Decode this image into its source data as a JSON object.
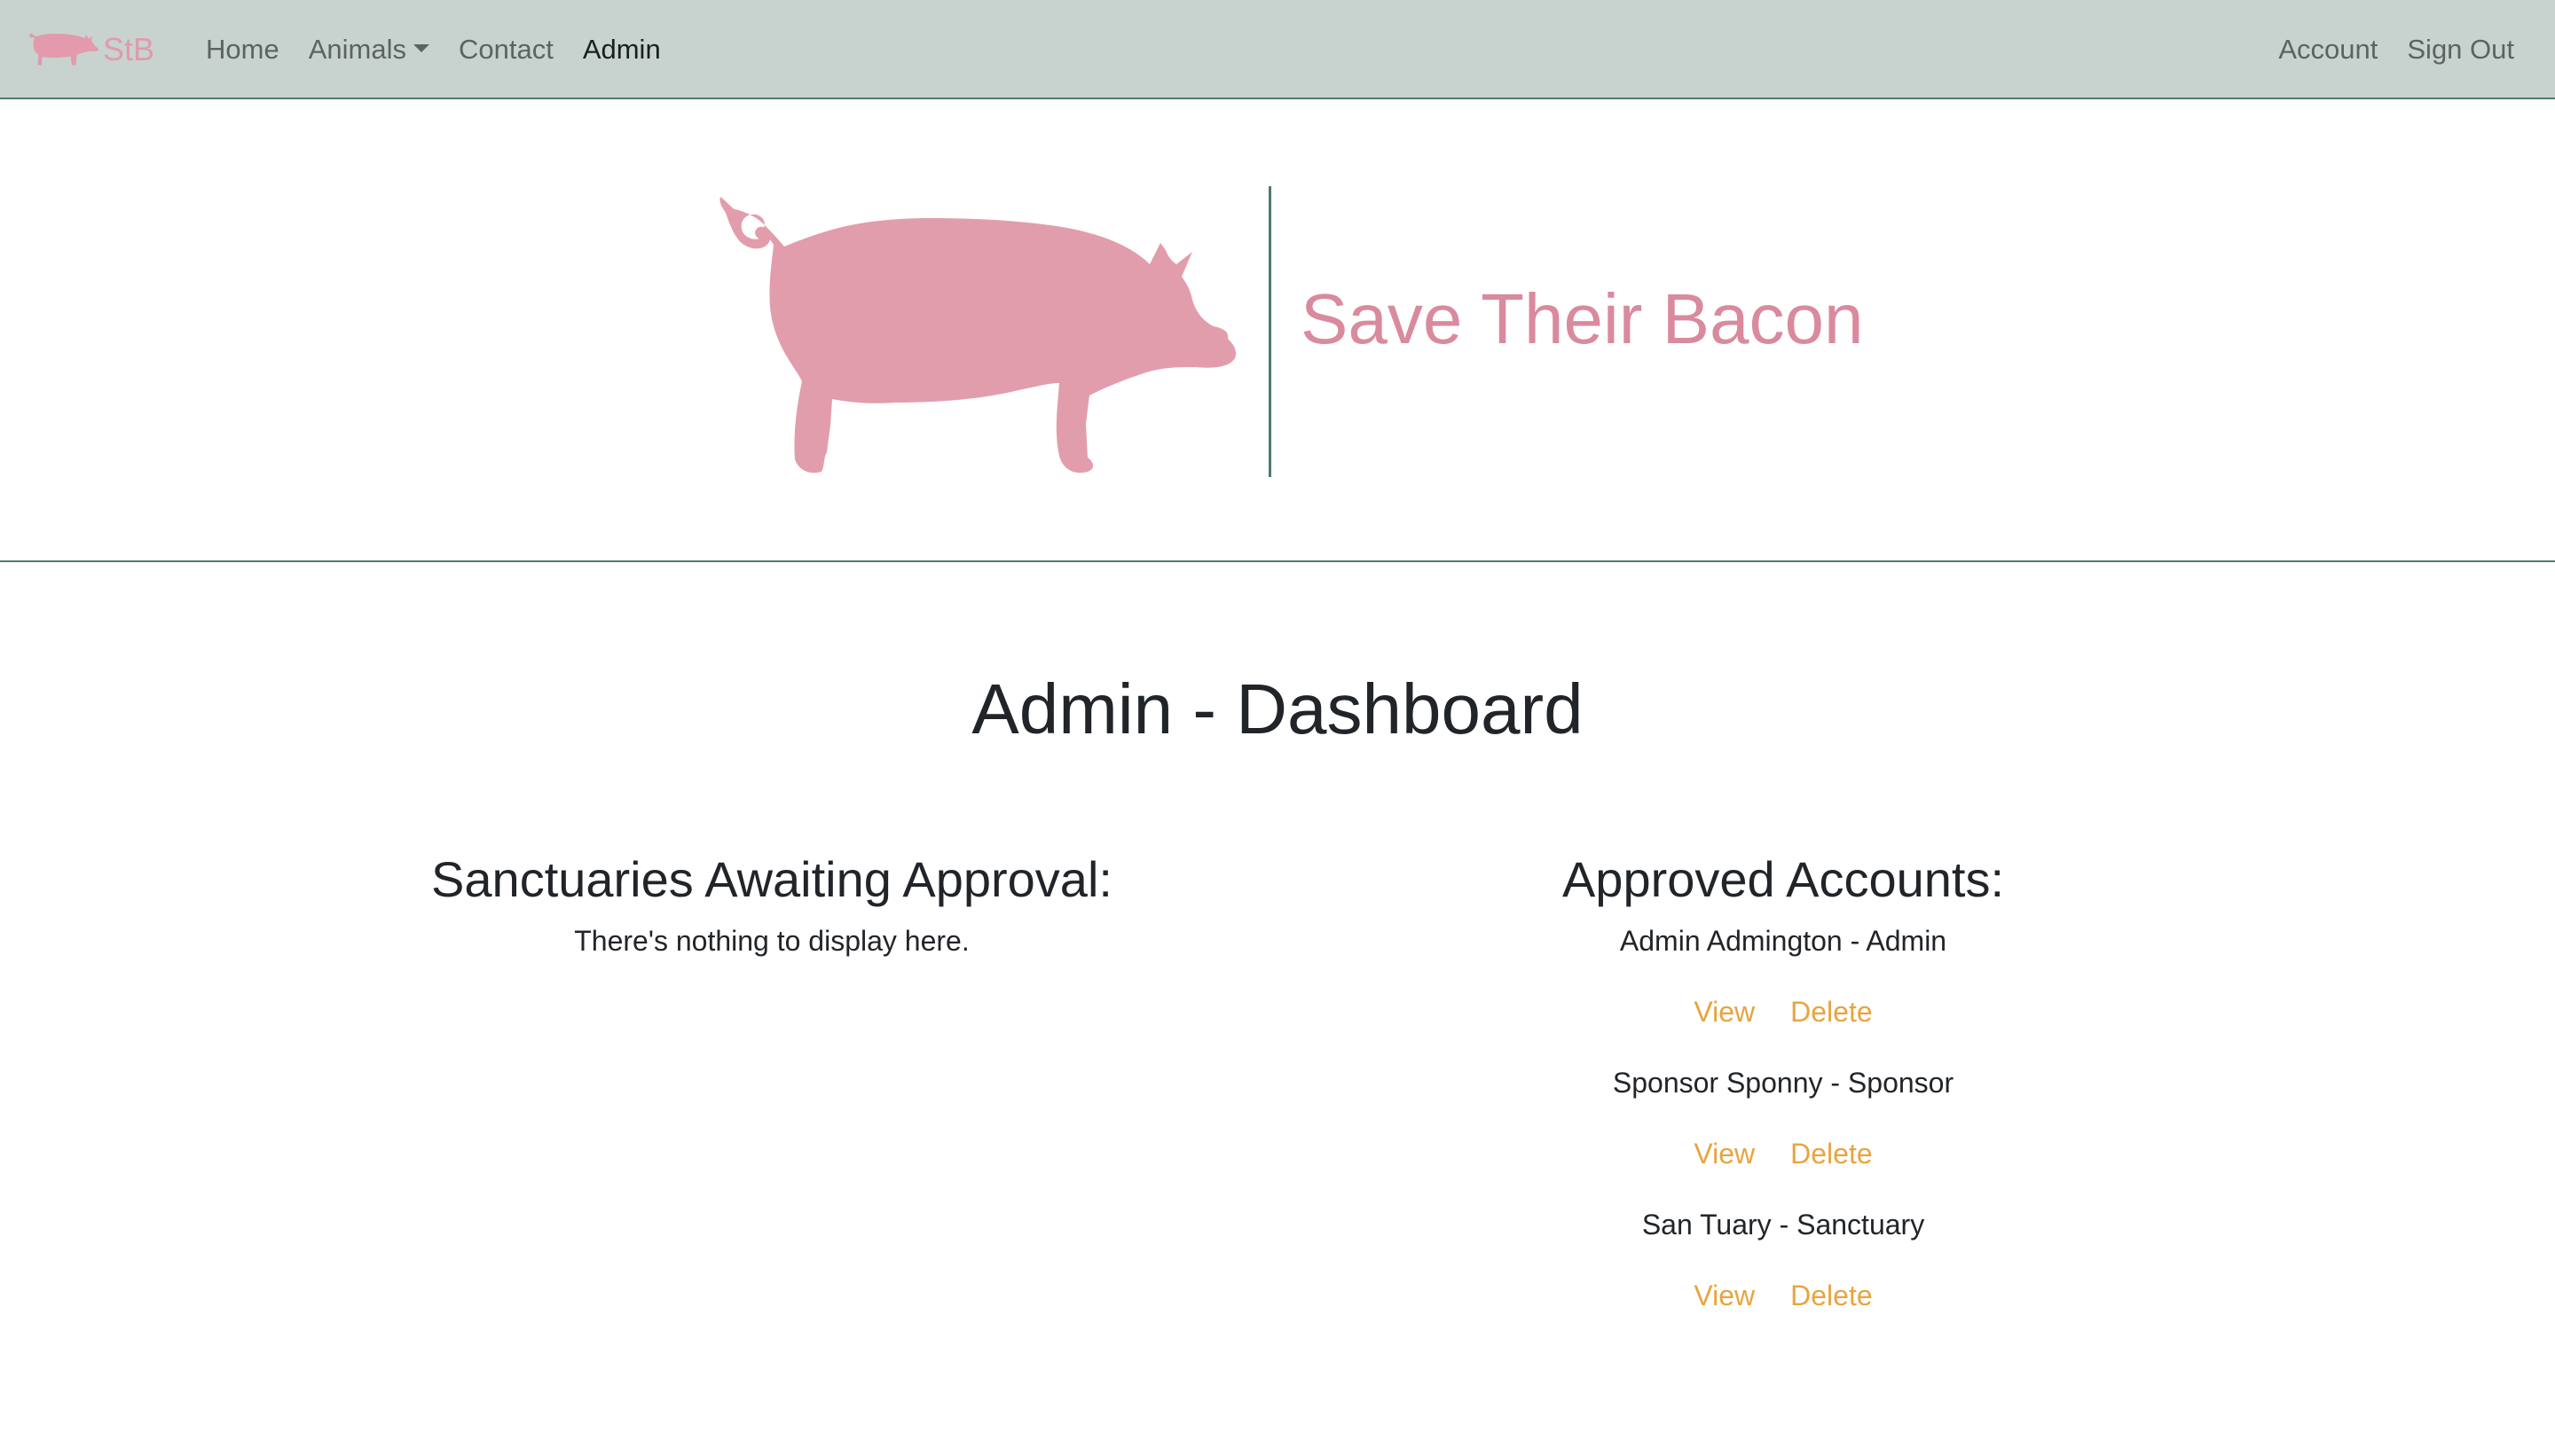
{
  "navbar": {
    "brand_text": "StB",
    "brand_icon": "pig-icon",
    "links": [
      {
        "label": "Home"
      },
      {
        "label": "Animals"
      },
      {
        "label": "Contact"
      },
      {
        "label": "Admin"
      }
    ],
    "right_links": [
      {
        "label": "Account"
      },
      {
        "label": "Sign Out"
      }
    ]
  },
  "hero": {
    "title": "Save Their Bacon",
    "image_icon": "pig-silhouette-icon"
  },
  "main": {
    "title": "Admin - Dashboard",
    "pending": {
      "heading": "Sanctuaries Awaiting Approval:",
      "empty_text": "There's nothing to display here."
    },
    "approved": {
      "heading": "Approved Accounts:",
      "accounts": [
        {
          "name": "Admin Admington - Admin",
          "view_label": "View",
          "delete_label": "Delete"
        },
        {
          "name": "Sponsor Sponny - Sponsor",
          "view_label": "View",
          "delete_label": "Delete"
        },
        {
          "name": "San Tuary - Sanctuary",
          "view_label": "View",
          "delete_label": "Delete"
        }
      ]
    }
  },
  "colors": {
    "navbar_bg": "#c8d3cf",
    "brand_pink": "#e29aac",
    "divider_teal": "#4f7a72",
    "link_orange": "#e8a43f"
  }
}
